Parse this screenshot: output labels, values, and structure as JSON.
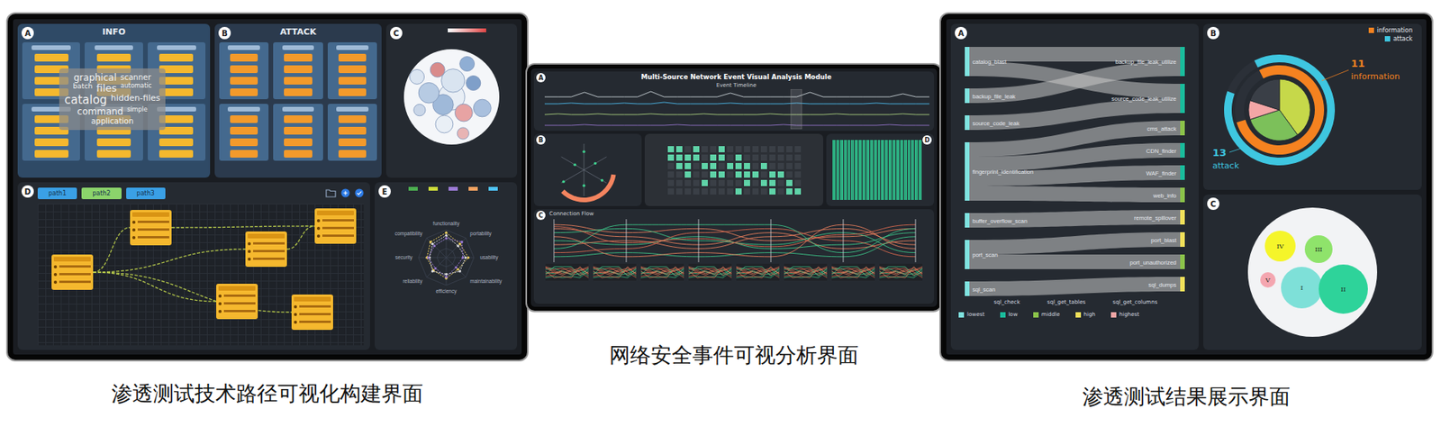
{
  "captions": [
    "渗透测试技术路径可视化构建界面",
    "网络安全事件可视分析界面",
    "渗透测试结果展示界面"
  ],
  "left": {
    "info": {
      "badge": "A",
      "title": "INFO",
      "cards": [
        {
          "bars": 4
        },
        {
          "bars": 4
        },
        {
          "bars": 4
        },
        {
          "bars": 4
        },
        {
          "bars": 4
        },
        {
          "bars": 4
        }
      ],
      "words": [
        {
          "text": "graphical",
          "size": 12
        },
        {
          "text": "scanner",
          "size": 10
        },
        {
          "text": "batch",
          "size": 9
        },
        {
          "text": "files",
          "size": 13
        },
        {
          "text": "automatic",
          "size": 8
        },
        {
          "text": "catalog",
          "size": 15
        },
        {
          "text": "hidden-files",
          "size": 11
        },
        {
          "text": "command",
          "size": 12
        },
        {
          "text": "simple",
          "size": 8
        },
        {
          "text": "application",
          "size": 10
        }
      ]
    },
    "attack": {
      "badge": "B",
      "title": "ATTACK",
      "cards": [
        {
          "bars": 4
        },
        {
          "bars": 4
        },
        {
          "bars": 4
        },
        {
          "bars": 4
        },
        {
          "bars": 4
        },
        {
          "bars": 4
        }
      ]
    },
    "bubbles": {
      "badge": "C",
      "circles": [
        {
          "value": 9,
          "color": "#e8eef5"
        },
        {
          "value": 7,
          "color": "#9fb9d9"
        },
        {
          "value": 8,
          "color": "#d9e4f0"
        },
        {
          "value": 6,
          "color": "#e7a3a3"
        },
        {
          "value": 7,
          "color": "#b7cbe3"
        },
        {
          "value": 5,
          "color": "#7f9fc9"
        },
        {
          "value": 6,
          "color": "#e9eff6"
        },
        {
          "value": 5,
          "color": "#d98b8b"
        },
        {
          "value": 6,
          "color": "#a9c0de"
        },
        {
          "value": 4,
          "color": "#c9d6e8"
        },
        {
          "value": 5,
          "color": "#8faed4"
        },
        {
          "value": 4,
          "color": "#e8b4b4"
        },
        {
          "value": 5,
          "color": "#dbe5f1"
        }
      ]
    },
    "paths": {
      "badge": "D",
      "tabs": [
        {
          "label": "path1",
          "selected": false
        },
        {
          "label": "path2",
          "selected": true
        },
        {
          "label": "path3",
          "selected": false
        }
      ],
      "nodes": [
        {
          "rows": 3
        },
        {
          "rows": 3
        },
        {
          "rows": 3
        },
        {
          "rows": 3
        },
        {
          "rows": 3
        },
        {
          "rows": 3
        }
      ],
      "edges": [
        [
          0,
          1
        ],
        [
          0,
          2
        ],
        [
          0,
          4
        ],
        [
          0,
          5
        ],
        [
          1,
          3
        ],
        [
          2,
          3
        ]
      ]
    },
    "radar": {
      "badge": "E",
      "legend": [
        {
          "color": "#4caf50"
        },
        {
          "color": "#cddc39"
        },
        {
          "color": "#9c7bd6"
        },
        {
          "color": "#f4a261"
        },
        {
          "color": "#4fc3f7"
        }
      ],
      "axes": [
        "functionality",
        "portability",
        "usability",
        "maintainability",
        "efficiency",
        "reliability",
        "security",
        "compatibility"
      ],
      "series": [
        {
          "color": "#f4d35e",
          "values": [
            0.9,
            0.7,
            0.8,
            0.6,
            0.75,
            0.65,
            0.7,
            0.8
          ]
        },
        {
          "color": "#e0e0e0",
          "values": [
            0.8,
            0.6,
            0.7,
            0.7,
            0.6,
            0.7,
            0.6,
            0.7
          ]
        },
        {
          "color": "#9c7bd6",
          "values": [
            0.7,
            0.8,
            0.6,
            0.5,
            0.7,
            0.55,
            0.65,
            0.6
          ]
        }
      ]
    }
  },
  "middle": {
    "title": "Multi-Source Network Event Visual Analysis Module",
    "timeline": {
      "badge": "A",
      "title": "Event Timeline",
      "series": [
        {
          "color": "#cfd8dc",
          "values": [
            2,
            2,
            2,
            8,
            2,
            2,
            2,
            2,
            9,
            2,
            2,
            2,
            2,
            2,
            7,
            2,
            2,
            2,
            2,
            2,
            8,
            2,
            2,
            2,
            2,
            2,
            2,
            6,
            2,
            2
          ]
        },
        {
          "color": "#4fc3f7",
          "values": [
            5,
            5,
            6,
            5,
            5,
            5,
            6,
            5,
            5,
            7,
            5,
            5,
            5,
            5,
            6,
            5,
            5,
            5,
            5,
            6,
            5,
            5,
            5,
            5,
            5,
            6,
            5,
            5,
            5,
            5
          ]
        },
        {
          "color": "#aed581",
          "values": [
            3,
            4,
            3,
            3,
            4,
            3,
            3,
            3,
            4,
            3,
            3,
            3,
            4,
            3,
            3,
            3,
            3,
            4,
            3,
            3,
            3,
            3,
            4,
            3,
            3,
            3,
            3,
            4,
            3,
            3
          ]
        },
        {
          "color": "#9575cd",
          "values": [
            1,
            1,
            1,
            2,
            1,
            1,
            1,
            1,
            1,
            1,
            2,
            1,
            1,
            1,
            1,
            1,
            1,
            1,
            2,
            1,
            1,
            1,
            1,
            1,
            1,
            1,
            2,
            1,
            1,
            1
          ]
        }
      ]
    },
    "radial": {
      "badge": "B",
      "points": [
        0.7,
        0.5,
        0.8,
        0.6,
        0.9,
        0.4
      ],
      "level": 0.35
    },
    "matrix": {
      "rows": [
        [
          1,
          1,
          0,
          1,
          0,
          0,
          1,
          0,
          0,
          0,
          0,
          0,
          0,
          0,
          0,
          0
        ],
        [
          1,
          1,
          1,
          1,
          0,
          1,
          1,
          0,
          1,
          0,
          0,
          0,
          0,
          0,
          0,
          0
        ],
        [
          0,
          1,
          1,
          0,
          1,
          1,
          0,
          1,
          1,
          1,
          0,
          1,
          0,
          0,
          0,
          0
        ],
        [
          0,
          0,
          1,
          0,
          0,
          1,
          1,
          0,
          1,
          1,
          1,
          0,
          1,
          1,
          0,
          0
        ],
        [
          0,
          0,
          0,
          0,
          1,
          0,
          0,
          0,
          0,
          1,
          0,
          1,
          1,
          0,
          1,
          0
        ],
        [
          0,
          0,
          0,
          0,
          0,
          0,
          0,
          0,
          1,
          0,
          0,
          0,
          1,
          0,
          1,
          1
        ]
      ]
    },
    "heat": {
      "badge": "D",
      "columns": [
        0.9,
        0.85,
        0.92,
        0.88,
        0.9,
        0.86,
        0.93,
        0.9,
        0.87,
        0.91,
        0.89,
        0.9,
        0.86,
        0.92,
        0.88,
        0.9,
        0.87,
        0.91,
        0.9,
        0.88,
        0.92,
        0.86,
        0.9,
        0.89
      ]
    },
    "flow": {
      "badge": "C",
      "title": "Connection Flow",
      "lines": [
        {
          "color": "#f4845f",
          "values": [
            0.1,
            0.3,
            0.2,
            0.5,
            0.4,
            0.2
          ]
        },
        {
          "color": "#f4845f",
          "values": [
            0.2,
            0.4,
            0.6,
            0.3,
            0.7,
            0.5
          ]
        },
        {
          "color": "#3ecf8e",
          "values": [
            0.3,
            0.2,
            0.5,
            0.6,
            0.3,
            0.8
          ]
        },
        {
          "color": "#3ecf8e",
          "values": [
            0.5,
            0.6,
            0.4,
            0.7,
            0.6,
            0.3
          ]
        },
        {
          "color": "#f4845f",
          "values": [
            0.6,
            0.5,
            0.7,
            0.4,
            0.2,
            0.6
          ]
        },
        {
          "color": "#e76f51",
          "values": [
            0.8,
            0.7,
            0.3,
            0.2,
            0.5,
            0.9
          ]
        },
        {
          "color": "#3ecf8e",
          "values": [
            0.9,
            0.8,
            0.9,
            0.8,
            0.9,
            0.4
          ]
        },
        {
          "color": "#f4845f",
          "values": [
            0.4,
            0.9,
            0.8,
            0.9,
            0.1,
            0.7
          ]
        },
        {
          "color": "#3ecf8e",
          "values": [
            0.7,
            0.1,
            0.1,
            0.1,
            0.8,
            0.2
          ]
        },
        {
          "color": "#e76f51",
          "values": [
            0.15,
            0.55,
            0.45,
            0.65,
            0.35,
            0.1
          ]
        }
      ]
    }
  },
  "right": {
    "sankey": {
      "badge": "A",
      "left": [
        "catalog_blast",
        "backup_file_leak",
        "source_code_leak",
        "fingerprint_identification",
        "buffer_overflow_scan",
        "port_scan",
        "sql_scan"
      ],
      "right": [
        {
          "label": "backup_file_leak_utilize",
          "color": "#1abc9c"
        },
        {
          "label": "source_code_leak_utilize",
          "color": "#1abc9c"
        },
        {
          "label": "cms_attack",
          "color": "#8bc34a"
        },
        {
          "label": "CDN_finder",
          "color": "#1abc9c"
        },
        {
          "label": "WAF_finder",
          "color": "#1abc9c"
        },
        {
          "label": "web_info",
          "color": "#8bc34a"
        },
        {
          "label": "remote_spillover",
          "color": "#f1e05a"
        },
        {
          "label": "port_blast",
          "color": "#f1e05a"
        },
        {
          "label": "port_unauthorized",
          "color": "#8bc34a"
        },
        {
          "label": "sql_dumps",
          "color": "#f1e05a"
        }
      ],
      "flows": [
        [
          0,
          0,
          1
        ],
        [
          0,
          1,
          1
        ],
        [
          1,
          0,
          1
        ],
        [
          2,
          1,
          1
        ],
        [
          3,
          2,
          1
        ],
        [
          3,
          3,
          1
        ],
        [
          3,
          4,
          1
        ],
        [
          3,
          5,
          1
        ],
        [
          4,
          6,
          1
        ],
        [
          5,
          7,
          1
        ],
        [
          5,
          8,
          1
        ],
        [
          6,
          9,
          1
        ]
      ],
      "chain": [
        "sql_check",
        "sql_get_tables",
        "sql_get_columns"
      ],
      "legend": [
        {
          "label": "lowest",
          "color": "#7fe3e0"
        },
        {
          "label": "low",
          "color": "#1abc9c"
        },
        {
          "label": "middle",
          "color": "#8bc34a"
        },
        {
          "label": "high",
          "color": "#f1e05a"
        },
        {
          "label": "highest",
          "color": "#f4a6a6"
        }
      ]
    },
    "sunburst": {
      "badge": "B",
      "inner": [
        {
          "value": 4,
          "color": "#c6d84a"
        },
        {
          "value": 3,
          "color": "#7cc05a"
        },
        {
          "value": 1,
          "color": "#f4a6a6"
        },
        {
          "value": 2,
          "color": "#3a3f47"
        }
      ],
      "rings": [
        {
          "label": "information",
          "count": "11",
          "color": "#f58220",
          "level": 0.78
        },
        {
          "label": "attack",
          "count": "13",
          "color": "#3ec6e0",
          "level": 0.88
        }
      ]
    },
    "bubbles": {
      "badge": "C",
      "circles": [
        {
          "label": "IV",
          "value": 20,
          "color": "#f5f52a"
        },
        {
          "label": "III",
          "value": 18,
          "color": "#8fe36b"
        },
        {
          "label": "V",
          "value": 10,
          "color": "#f4a6b0"
        },
        {
          "label": "I",
          "value": 27,
          "color": "#7ee0d8"
        },
        {
          "label": "II",
          "value": 32,
          "color": "#2ed39a"
        }
      ]
    }
  }
}
